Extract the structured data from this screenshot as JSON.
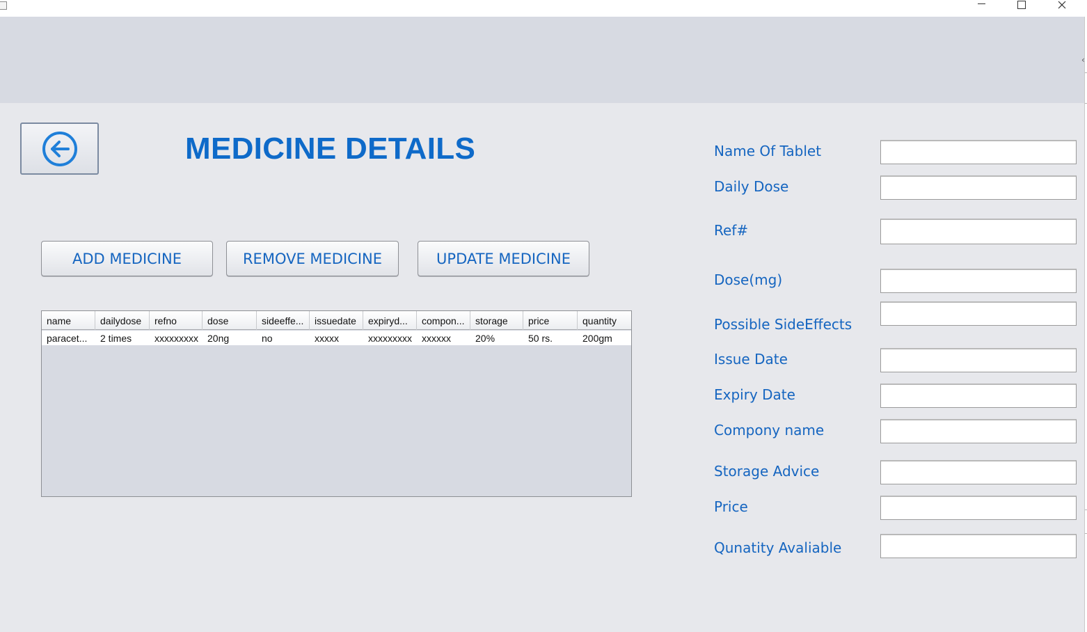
{
  "window": {
    "minimize_icon": "minimize-icon",
    "maximize_icon": "maximize-icon",
    "close_icon": "close-icon"
  },
  "header": {
    "title": "MEDICINE DETAILS",
    "back_icon": "back-arrow-icon",
    "title_color": "#0e6ac9"
  },
  "actions": {
    "add_label": "ADD MEDICINE",
    "remove_label": "REMOVE MEDICINE",
    "update_label": "UPDATE MEDICINE"
  },
  "table": {
    "columns": [
      "name",
      "dailydose",
      "refno",
      "dose",
      "sideeffe...",
      "issuedate",
      "expiryd...",
      "compon...",
      "storage",
      "price",
      "quantity"
    ],
    "rows": [
      [
        "paracet...",
        "2 times",
        "xxxxxxxxx",
        "20ng",
        "no",
        "xxxxx",
        "xxxxxxxxx",
        "xxxxxx",
        "20%",
        "50 rs.",
        "200gm"
      ]
    ]
  },
  "form": {
    "fields": [
      {
        "label": "Name Of Tablet",
        "value": ""
      },
      {
        "label": "Daily Dose",
        "value": ""
      },
      {
        "label": "Ref#",
        "value": ""
      },
      {
        "label": "Dose(mg)",
        "value": ""
      },
      {
        "label": "Possible SideEffects",
        "value": ""
      },
      {
        "label": "Issue Date",
        "value": ""
      },
      {
        "label": "Expiry Date",
        "value": ""
      },
      {
        "label": "Compony name",
        "value": ""
      },
      {
        "label": "Storage Advice",
        "value": ""
      },
      {
        "label": "Price",
        "value": ""
      },
      {
        "label": "Qunatity Avaliable",
        "value": ""
      }
    ]
  },
  "colors": {
    "accent": "#1565c0",
    "panel": "#e7e8ec",
    "band": "#d7dae2"
  }
}
